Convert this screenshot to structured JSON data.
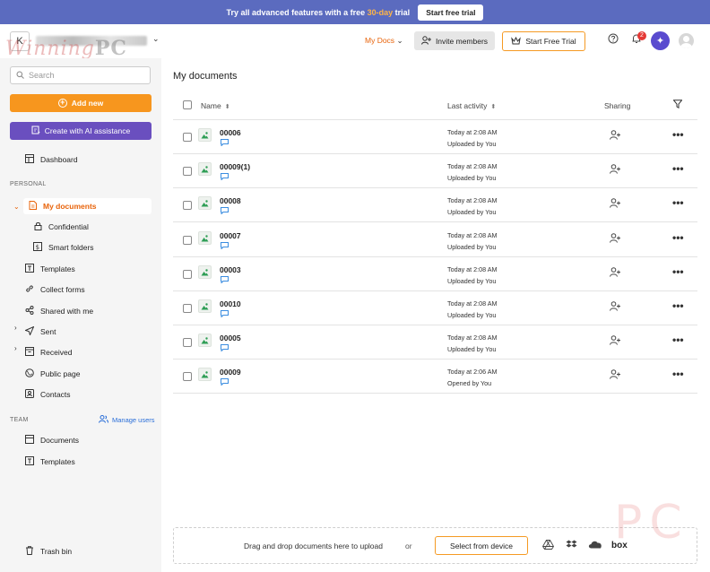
{
  "banner": {
    "text_before": "Try all advanced features with a free",
    "highlight": "30-day",
    "text_after": "trial",
    "button_label": "Start free trial"
  },
  "header": {
    "workspace_initial": "K",
    "watermark_left": "Winning",
    "watermark_right": "PC",
    "my_docs_label": "My Docs",
    "invite_label": "Invite members",
    "trial_label": "Start Free Trial",
    "notification_count": "2"
  },
  "sidebar": {
    "search_placeholder": "Search",
    "add_new_label": "Add new",
    "ai_label": "Create with AI assistance",
    "dashboard": "Dashboard",
    "personal_section": "PERSONAL",
    "items": {
      "my_documents": "My documents",
      "confidential": "Confidential",
      "smart_folders": "Smart folders",
      "templates": "Templates",
      "collect_forms": "Collect forms",
      "shared_with_me": "Shared with me",
      "sent": "Sent",
      "received": "Received",
      "public_page": "Public page",
      "contacts": "Contacts"
    },
    "team_section": "TEAM",
    "manage_users": "Manage users",
    "team_items": {
      "documents": "Documents",
      "templates": "Templates"
    },
    "trash": "Trash bin"
  },
  "main": {
    "title": "My documents",
    "columns": {
      "name": "Name",
      "last_activity": "Last activity",
      "sharing": "Sharing"
    },
    "rows": [
      {
        "name": "00006",
        "time": "Today at 2:08 AM",
        "action": "Uploaded by You"
      },
      {
        "name": "00009(1)",
        "time": "Today at 2:08 AM",
        "action": "Uploaded by You"
      },
      {
        "name": "00008",
        "time": "Today at 2:08 AM",
        "action": "Uploaded by You"
      },
      {
        "name": "00007",
        "time": "Today at 2:08 AM",
        "action": "Uploaded by You"
      },
      {
        "name": "00003",
        "time": "Today at 2:08 AM",
        "action": "Uploaded by You"
      },
      {
        "name": "00010",
        "time": "Today at 2:08 AM",
        "action": "Uploaded by You"
      },
      {
        "name": "00005",
        "time": "Today at 2:08 AM",
        "action": "Uploaded by You"
      },
      {
        "name": "00009",
        "time": "Today at 2:06 AM",
        "action": "Opened by You"
      }
    ],
    "upload": {
      "text": "Drag and drop documents here to upload",
      "or": "or",
      "select_label": "Select from device",
      "box_label": "box"
    }
  },
  "corner_watermark": "PC",
  "colors": {
    "banner": "#5b6bbf",
    "accent_orange": "#f7961e",
    "ai_purple": "#6a4fbf",
    "link_blue": "#2a6ed8"
  }
}
